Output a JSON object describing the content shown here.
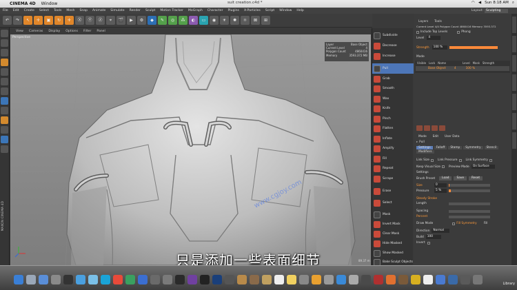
{
  "mac_menubar": {
    "app": "CINEMA 4D",
    "menu": [
      "Window"
    ],
    "window_title": "suit creation.c4d *",
    "clock": "Sun 8:18 AM"
  },
  "c4d_menu": {
    "items": [
      "File",
      "Edit",
      "Create",
      "Select",
      "Tools",
      "Mesh",
      "Snap",
      "Animate",
      "Simulate",
      "Render",
      "Sculpt",
      "Motion Tracker",
      "MoGraph",
      "Character",
      "Plugins",
      "X-Particles",
      "Script",
      "Window",
      "Help"
    ],
    "layout_label": "Layout:",
    "layout_value": "Sculpting"
  },
  "viewport": {
    "menu": [
      "View",
      "Cameras",
      "Display",
      "Options",
      "Filter",
      "Panel"
    ],
    "label": "Perspective",
    "info": [
      {
        "k": "Layer",
        "v": "Base Object"
      },
      {
        "k": "Current Level",
        "v": "4"
      },
      {
        "k": "Polygon Count",
        "v": "4860416"
      },
      {
        "k": "Memory",
        "v": "3593.372 MB"
      }
    ],
    "subtitle": "只是添加一些表面细节",
    "watermark": "www.cgjoy.com",
    "brand": "MAXON CINEMA 4D",
    "zoom": "89.37 m"
  },
  "brushes": [
    {
      "label": "Subdivide",
      "selected": false
    },
    {
      "label": "Decrease",
      "selected": false
    },
    {
      "label": "Increase",
      "selected": false
    },
    {
      "label": "Pull",
      "selected": true
    },
    {
      "label": "Grab",
      "selected": false
    },
    {
      "label": "Smooth",
      "selected": false
    },
    {
      "label": "Wax",
      "selected": false
    },
    {
      "label": "Knife",
      "selected": false
    },
    {
      "label": "Pinch",
      "selected": false
    },
    {
      "label": "Flatten",
      "selected": false
    },
    {
      "label": "Inflate",
      "selected": false
    },
    {
      "label": "Amplify",
      "selected": false
    },
    {
      "label": "Fill",
      "selected": false
    },
    {
      "label": "Repeat",
      "selected": false
    },
    {
      "label": "Scrape",
      "selected": false
    },
    {
      "label": "Erase",
      "selected": false
    },
    {
      "label": "Select",
      "selected": false
    },
    {
      "label": "Mask",
      "selected": false
    },
    {
      "label": "Invert Mask",
      "selected": false
    },
    {
      "label": "Clear Mask",
      "selected": false
    },
    {
      "label": "Hide Masked",
      "selected": false
    },
    {
      "label": "Show Masked",
      "selected": false
    },
    {
      "label": "Bake Sculpt Objects",
      "selected": false
    }
  ],
  "layers_panel": {
    "tabs": [
      "Layers",
      "Tools"
    ],
    "current_level": "Current Level  4/4  Polygon Count  4860416  Memory  3593.372",
    "include_top": "Include Top Levels",
    "phong": "Phong",
    "level_label": "Level",
    "level_value": "4",
    "strength_label": "Strength",
    "strength_value": "100 %",
    "strength_fill": 1.0,
    "mode_label": "Mode",
    "table_headers": [
      "Visible",
      "Lock",
      "Name",
      "Level",
      "Mask",
      "Strength"
    ],
    "table_row": {
      "name": "Base Object",
      "level": "4",
      "strength": "100 %"
    }
  },
  "attributes": {
    "tabs": [
      "Mode",
      "Edit",
      "User Data"
    ],
    "tool_name": "Pull",
    "subtabs": [
      "Settings",
      "Falloff",
      "Stamp",
      "Symmetry",
      "Stencil"
    ],
    "modifiers_tab": "Modifiers",
    "link_size": "Link Size",
    "link_pressure": "Link Pressure",
    "link_symmetry": "Link Symmetry",
    "keep_visual": "Keep Visual Size",
    "preview_mode_label": "Preview Mode",
    "preview_mode_value": "On Surface",
    "settings_header": "Settings",
    "brush_preset": "Brush Preset",
    "load": "Load",
    "save": "Save",
    "reset": "Reset",
    "size_label": "Size",
    "size_value": "0",
    "size_fill": 0.02,
    "pressure_label": "Pressure",
    "pressure_value": "5 %",
    "pressure_fill": 0.05,
    "steady_stroke": "Steady Stroke",
    "length_label": "Length",
    "spacing_label": "Spacing",
    "percent_label": "Percent",
    "draw_mode_label": "Draw Mode",
    "fill_symmetry": "Fill Symmetry",
    "fill": "Fill",
    "direction_label": "Direction",
    "direction_value": "Normal",
    "build_label": "Build",
    "build_value": "100",
    "invert_label": "Invert"
  },
  "dock": {
    "right_label": "Library"
  },
  "colors": {
    "accent_orange": "#ff8a3a",
    "selection_blue": "#4d76b8",
    "brush_red": "#c94a3a"
  }
}
